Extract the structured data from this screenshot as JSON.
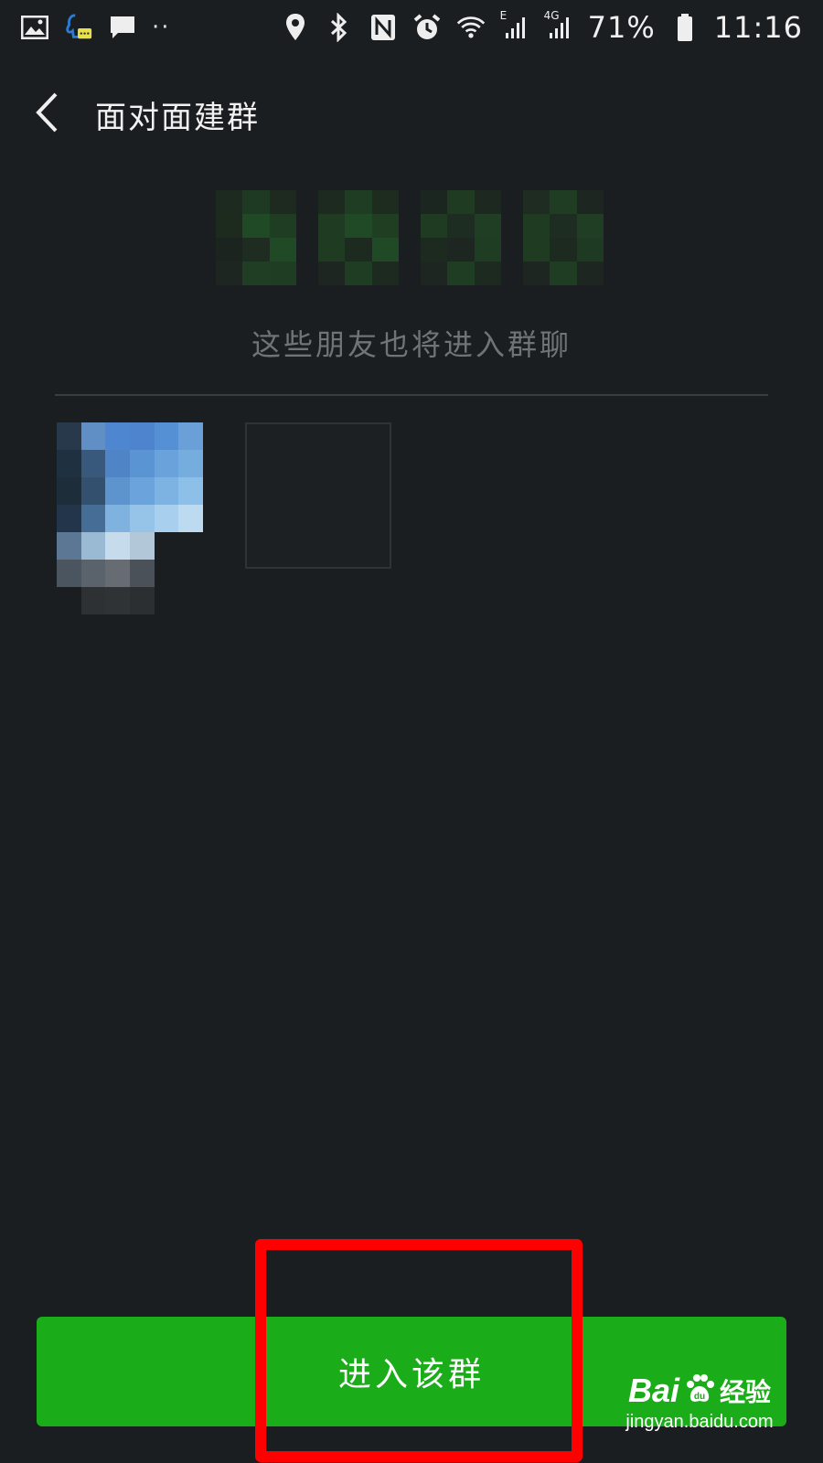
{
  "status_bar": {
    "left_icons": [
      "image-icon",
      "qq-notification-icon",
      "message-icon"
    ],
    "more_dots": "··",
    "right_icons": [
      "location-icon",
      "bluetooth-icon",
      "nfc-icon",
      "alarm-icon",
      "wifi-icon",
      "signal-e-icon",
      "signal-4g-icon",
      "battery-icon"
    ],
    "signal_e_label": "E",
    "signal_4g_label": "4G",
    "battery_percent": "71%",
    "time": "11:16"
  },
  "nav": {
    "title": "面对面建群"
  },
  "code": {
    "digits_count": 4,
    "obscured": true
  },
  "hint": "这些朋友也将进入群聊",
  "members": {
    "avatar_count": 1,
    "has_empty_slot": true
  },
  "action": {
    "enter_label": "进入该群"
  },
  "watermark": {
    "brand": "Bai",
    "brand_suffix": "经验",
    "url": "jingyan.baidu.com"
  },
  "colors": {
    "background": "#1b1e20",
    "primary_green": "#1aad19",
    "highlight_red": "#ff0000",
    "hint_gray": "#6f7478"
  }
}
